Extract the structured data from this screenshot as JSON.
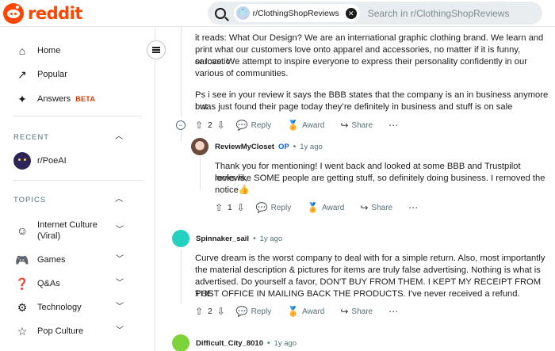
{
  "header": {
    "logo_text": "reddit",
    "search": {
      "community_chip": "r/ClothingShopReviews",
      "placeholder": "Search in r/ClothingShopReviews"
    }
  },
  "sidebar": {
    "nav": [
      {
        "label": "Home",
        "icon": "home-icon"
      },
      {
        "label": "Popular",
        "icon": "popular-icon"
      },
      {
        "label": "Answers",
        "icon": "answers-icon",
        "badge": "BETA"
      }
    ],
    "recent": {
      "title": "RECENT",
      "items": [
        {
          "label": "r/PoeAI"
        }
      ]
    },
    "topics": {
      "title": "TOPICS",
      "items": [
        {
          "label": "Internet Culture (Viral)",
          "label_line1": "Internet Culture",
          "label_line2": "(Viral)",
          "icon": "smile-icon"
        },
        {
          "label": "Games",
          "icon": "gamepad-icon"
        },
        {
          "label": "Q&As",
          "icon": "question-icon"
        },
        {
          "label": "Technology",
          "icon": "gear-icon"
        },
        {
          "label": "Pop Culture",
          "icon": "star-icon"
        }
      ]
    }
  },
  "comments": {
    "c1": {
      "body_line0": "it reads: What Our Design? We are an international graphic clothing brand. We learn and",
      "body_line1": "print what our customers love onto apparel and accessories, no matter if it is funny, sarcastic",
      "body_line2": "or love. We attempt to inspire everyone to express their personality confidently in our",
      "body_line3": "various of communities.",
      "body_line4": "Ps i see in your review it says the BBB states that the company is an in business anymore but",
      "body_line5": "I was just found their page today they’re definitely in business and stuff is on sale",
      "votes": "2",
      "reply": "Reply",
      "award": "Award",
      "share": "Share"
    },
    "c2": {
      "author": "ReviewMyCloset",
      "op": "OP",
      "time": "1y ago",
      "body_line0": "Thank you for mentioning! I went back and looked at some BBB and Trustpilot reviews,",
      "body_line1": "looks like SOME people are getting stuff, so definitely doing business. I removed the",
      "body_line2": "notice👍",
      "votes": "1",
      "reply": "Reply",
      "award": "Award",
      "share": "Share"
    },
    "c3": {
      "author": "Spinnaker_sail",
      "time": "1y ago",
      "body_line0": "Curve dream is the worst company to deal with for a simple return. Also, most importantly",
      "body_line1": "the material description & pictures for items are truly false advertising. Nothing is what is",
      "body_line2": "advertised.  Do yourself a favor,  DON'T BUY FROM THEM. I KEPT MY RECEIPT FROM THE",
      "body_line3": "POST OFFICE IN MAILING BACK THE PRODUCTS. I've never received a refund.",
      "votes": "2",
      "reply": "Reply",
      "award": "Award",
      "share": "Share"
    },
    "c4": {
      "author": "Difficult_City_8010",
      "time": "1y ago"
    }
  },
  "colors": {
    "brand": "#ff4500",
    "op_blue": "#0a5fd8",
    "search_bg": "#eaedef"
  }
}
